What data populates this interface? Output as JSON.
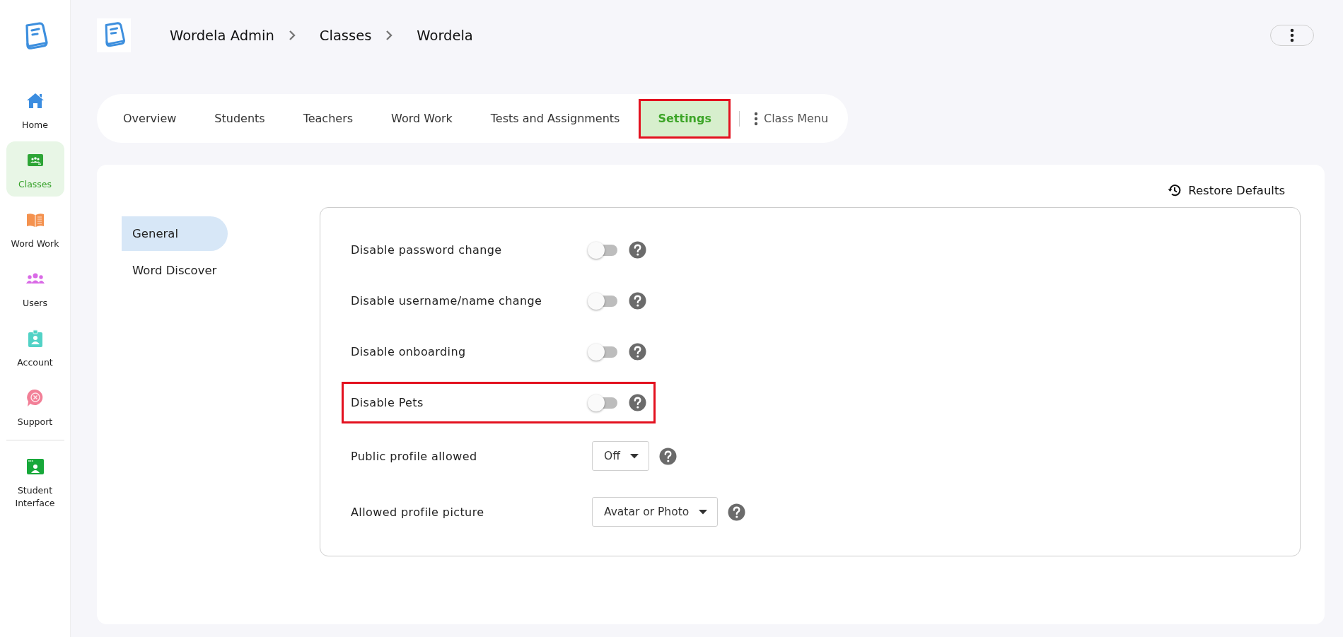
{
  "sidebar": {
    "items": [
      {
        "label": "Home",
        "kind": "home",
        "selected": false
      },
      {
        "label": "Classes",
        "kind": "classes",
        "selected": true
      },
      {
        "label": "Word Work",
        "kind": "book",
        "selected": false
      },
      {
        "label": "Users",
        "kind": "users",
        "selected": false
      },
      {
        "label": "Account",
        "kind": "account",
        "selected": false
      },
      {
        "label": "Support",
        "kind": "support",
        "selected": false
      }
    ],
    "bottom_items": [
      {
        "label": "Student Interface",
        "kind": "student",
        "selected": false
      }
    ]
  },
  "breadcrumb": [
    "Wordela Admin",
    "Classes",
    "Wordela"
  ],
  "tabs": [
    {
      "label": "Overview",
      "selected": false,
      "highlighted": false
    },
    {
      "label": "Students",
      "selected": false,
      "highlighted": false
    },
    {
      "label": "Teachers",
      "selected": false,
      "highlighted": false
    },
    {
      "label": "Word Work",
      "selected": false,
      "highlighted": false
    },
    {
      "label": "Tests and Assignments",
      "selected": false,
      "highlighted": false
    },
    {
      "label": "Settings",
      "selected": true,
      "highlighted": true
    }
  ],
  "class_menu": {
    "label": "Class Menu"
  },
  "restore_button": {
    "label": "Restore Defaults"
  },
  "settings_nav": [
    {
      "label": "General",
      "selected": true
    },
    {
      "label": "Word Discover",
      "selected": false
    }
  ],
  "settings": {
    "rows": [
      {
        "label": "Disable password change",
        "kind": "toggle",
        "on": false,
        "highlighted": false
      },
      {
        "label": "Disable username/name change",
        "kind": "toggle",
        "on": false,
        "highlighted": false
      },
      {
        "label": "Disable onboarding",
        "kind": "toggle",
        "on": false,
        "highlighted": false
      },
      {
        "label": "Disable Pets",
        "kind": "toggle",
        "on": false,
        "highlighted": true
      },
      {
        "label": "Public profile allowed",
        "kind": "select",
        "value": "Off",
        "highlighted": false
      },
      {
        "label": "Allowed profile picture",
        "kind": "select",
        "value": "Avatar or Photo",
        "highlighted": false
      }
    ]
  }
}
